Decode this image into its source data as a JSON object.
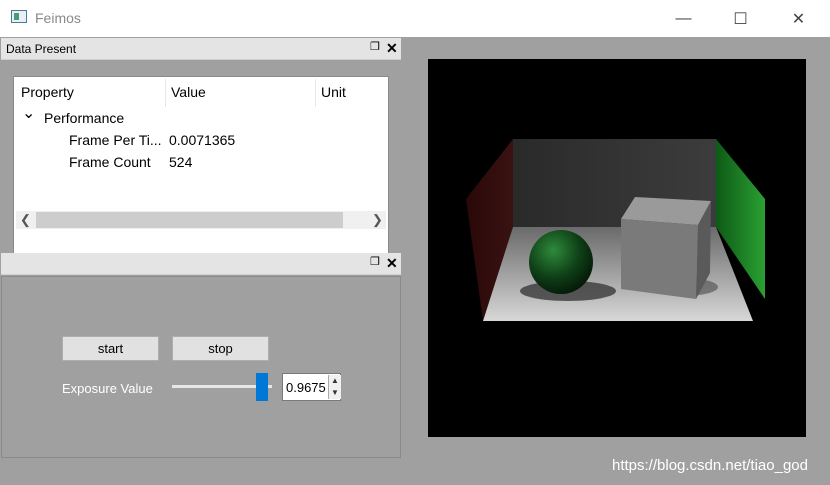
{
  "window": {
    "title": "Feimos",
    "minimize_glyph": "—",
    "maximize_glyph": "☐",
    "close_glyph": "✕"
  },
  "data_present": {
    "title": "Data Present",
    "float_glyph": "❐",
    "close_glyph": "✕",
    "columns": [
      "Property",
      "Value",
      "Unit"
    ],
    "group": {
      "expander": "⌄",
      "label": "Performance",
      "rows": [
        {
          "property": "Frame Per Ti...",
          "value": "0.0071365",
          "unit": ""
        },
        {
          "property": "Frame Count",
          "value": "524",
          "unit": ""
        }
      ]
    },
    "scroll_left": "❮",
    "scroll_right": "❯"
  },
  "controls": {
    "float_glyph": "❐",
    "close_glyph": "✕",
    "start_label": "start",
    "stop_label": "stop",
    "exposure_label": "Exposure Value",
    "exposure_value": "0.9675",
    "spin_up": "▲",
    "spin_down": "▼",
    "slider_fraction": 0.9
  },
  "watermark": "https://blog.csdn.net/tiao_god",
  "colors": {
    "accent": "#0078d7",
    "green_wall": "#1f8a2a",
    "red_wall": "#4a1010"
  }
}
